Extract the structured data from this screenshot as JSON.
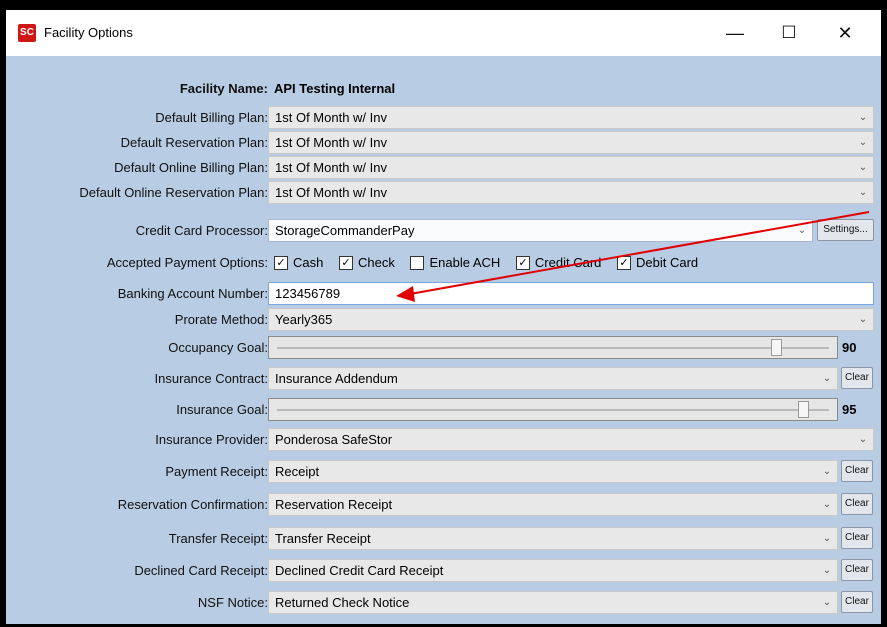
{
  "window": {
    "title": "Facility Options",
    "app_icon_text": "SC",
    "buttons": {
      "minimize": "—",
      "maximize": "☐",
      "close": "✕"
    }
  },
  "facility": {
    "label": "Facility Name:",
    "value": "API Testing Internal"
  },
  "fields": {
    "default_billing_plan": {
      "label": "Default Billing Plan:",
      "value": "1st Of Month w/ Inv"
    },
    "default_reservation_plan": {
      "label": "Default Reservation Plan:",
      "value": "1st Of Month w/ Inv"
    },
    "default_online_billing_plan": {
      "label": "Default Online Billing Plan:",
      "value": "1st Of Month w/ Inv"
    },
    "default_online_reservation_plan": {
      "label": "Default Online Reservation Plan:",
      "value": "1st Of Month w/ Inv"
    },
    "credit_card_processor": {
      "label": "Credit Card Processor:",
      "value": "StorageCommanderPay",
      "settings_label": "Settings..."
    },
    "accepted_payment_options": {
      "label": "Accepted Payment Options:",
      "options": [
        {
          "label": "Cash",
          "checked": true
        },
        {
          "label": "Check",
          "checked": true
        },
        {
          "label": "Enable ACH",
          "checked": false
        },
        {
          "label": "Credit Card",
          "checked": true
        },
        {
          "label": "Debit Card",
          "checked": true
        }
      ]
    },
    "banking_account_number": {
      "label": "Banking Account Number:",
      "value": "123456789"
    },
    "prorate_method": {
      "label": "Prorate Method:",
      "value": "Yearly365"
    },
    "occupancy_goal": {
      "label": "Occupancy Goal:",
      "value": "90"
    },
    "insurance_contract": {
      "label": "Insurance Contract:",
      "value": "Insurance Addendum",
      "clear_label": "Clear"
    },
    "insurance_goal": {
      "label": "Insurance Goal:",
      "value": "95"
    },
    "insurance_provider": {
      "label": "Insurance Provider:",
      "value": "Ponderosa SafeStor"
    },
    "payment_receipt": {
      "label": "Payment Receipt:",
      "value": "Receipt",
      "clear_label": "Clear"
    },
    "reservation_confirmation": {
      "label": "Reservation Confirmation:",
      "value": "Reservation Receipt",
      "clear_label": "Clear"
    },
    "transfer_receipt": {
      "label": "Transfer Receipt:",
      "value": "Transfer Receipt",
      "clear_label": "Clear"
    },
    "declined_card_receipt": {
      "label": "Declined Card Receipt:",
      "value": "Declined Credit Card Receipt",
      "clear_label": "Clear"
    },
    "nsf_notice": {
      "label": "NSF Notice:",
      "value": "Returned Check Notice",
      "clear_label": "Clear"
    }
  },
  "colors": {
    "panel_bg": "#b8cce4",
    "annotation_arrow": "#e00000",
    "app_icon": "#d11616"
  },
  "icons": {
    "dropdown": "chevron-down-icon",
    "check": "check-icon"
  }
}
